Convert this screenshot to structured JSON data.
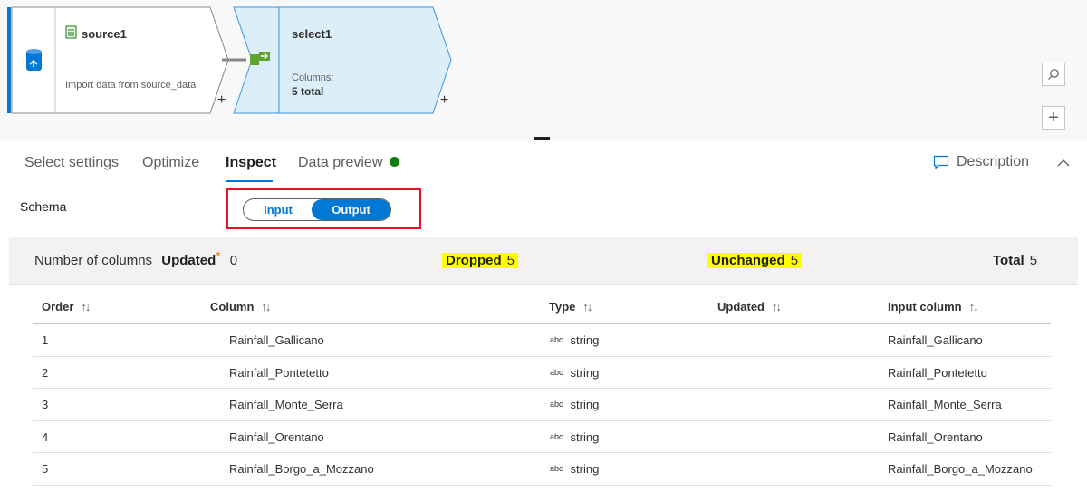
{
  "flow": {
    "source": {
      "title": "source1",
      "subtitle": "Import data from source_data"
    },
    "select": {
      "title": "select1",
      "columns_label": "Columns:",
      "columns_value": "5 total"
    },
    "add_symbol": "+",
    "zoom_in_symbol": "+"
  },
  "tabs": {
    "items": [
      {
        "label": "Select settings"
      },
      {
        "label": "Optimize"
      },
      {
        "label": "Inspect"
      },
      {
        "label": "Data preview"
      }
    ],
    "active_index": 2,
    "description_label": "Description"
  },
  "schema": {
    "label": "Schema",
    "toggle": {
      "input_label": "Input",
      "output_label": "Output",
      "selected": "Output"
    }
  },
  "summary": {
    "label": "Number of columns",
    "updated_label": "Updated",
    "updated_marker": "*",
    "updated_value": "0",
    "dropped_label": "Dropped",
    "dropped_value": "5",
    "unchanged_label": "Unchanged",
    "unchanged_value": "5",
    "total_label": "Total",
    "total_value": "5"
  },
  "table": {
    "columns": [
      "Order",
      "Column",
      "Type",
      "Updated",
      "Input column"
    ],
    "sort_glyph": "↑↓",
    "type_badge": "abc",
    "rows": [
      {
        "order": "1",
        "column": "Rainfall_Gallicano",
        "type": "string",
        "updated": "",
        "input_column": "Rainfall_Gallicano"
      },
      {
        "order": "2",
        "column": "Rainfall_Pontetetto",
        "type": "string",
        "updated": "",
        "input_column": "Rainfall_Pontetetto"
      },
      {
        "order": "3",
        "column": "Rainfall_Monte_Serra",
        "type": "string",
        "updated": "",
        "input_column": "Rainfall_Monte_Serra"
      },
      {
        "order": "4",
        "column": "Rainfall_Orentano",
        "type": "string",
        "updated": "",
        "input_column": "Rainfall_Orentano"
      },
      {
        "order": "5",
        "column": "Rainfall_Borgo_a_Mozzano",
        "type": "string",
        "updated": "",
        "input_column": "Rainfall_Borgo_a_Mozzano"
      }
    ]
  },
  "colors": {
    "accent": "#0078d4",
    "highlight": "#ffff00",
    "status_ok": "#107c10",
    "selection_border": "#e81123"
  }
}
